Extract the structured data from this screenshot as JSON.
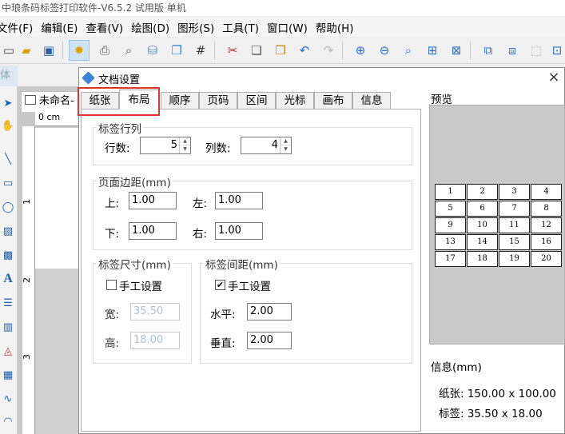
{
  "app": {
    "title": "中琅条码标签打印软件-V6.5.2 试用版 单机"
  },
  "menu": [
    {
      "label": "文件(F)"
    },
    {
      "label": "编辑(E)"
    },
    {
      "label": "查看(V)"
    },
    {
      "label": "绘图(D)"
    },
    {
      "label": "图形(S)"
    },
    {
      "label": "工具(T)"
    },
    {
      "label": "窗口(W)"
    },
    {
      "label": "帮助(H)"
    }
  ],
  "side": {
    "header": "体"
  },
  "document": {
    "tab_label": "未命名-",
    "ruler_unit": "0 cm",
    "ruler_left": [
      "1",
      "2",
      "3"
    ]
  },
  "dialog": {
    "title": "文档设置",
    "close": "×",
    "tabs": [
      "纸张",
      "布局",
      "顺序",
      "页码",
      "区间",
      "光标",
      "画布",
      "信息"
    ],
    "active_tab": "布局",
    "rows_cols": {
      "group_label": "标签行列",
      "rows_label": "行数:",
      "rows_value": "5",
      "cols_label": "列数:",
      "cols_value": "4"
    },
    "margins": {
      "group_label": "页面边距(mm)",
      "top_label": "上:",
      "top_value": "1.00",
      "left_label": "左:",
      "left_value": "1.00",
      "bottom_label": "下:",
      "bottom_value": "1.00",
      "right_label": "右:",
      "right_value": "1.00"
    },
    "label_size": {
      "group_label": "标签尺寸(mm)",
      "manual_label": "手工设置",
      "manual_checked": false,
      "width_label": "宽:",
      "width_value": "35.50",
      "height_label": "高:",
      "height_value": "18.00"
    },
    "spacing": {
      "group_label": "标签间距(mm)",
      "manual_label": "手工设置",
      "manual_checked": true,
      "check_mark": "✔",
      "horizontal_label": "水平:",
      "horizontal_value": "2.00",
      "vertical_label": "垂直:",
      "vertical_value": "2.00"
    },
    "preview": {
      "label": "预览",
      "cells": [
        "1",
        "2",
        "3",
        "4",
        "5",
        "6",
        "7",
        "8",
        "9",
        "10",
        "11",
        "12",
        "13",
        "14",
        "15",
        "16",
        "17",
        "18",
        "19",
        "20"
      ]
    },
    "info": {
      "label": "信息(mm)",
      "paper": "纸张: 150.00 x 100.00",
      "label_size": "标签: 35.50 x 18.00"
    }
  },
  "colors": {
    "highlight": "#e8332d",
    "accent": "#3a86d6"
  }
}
